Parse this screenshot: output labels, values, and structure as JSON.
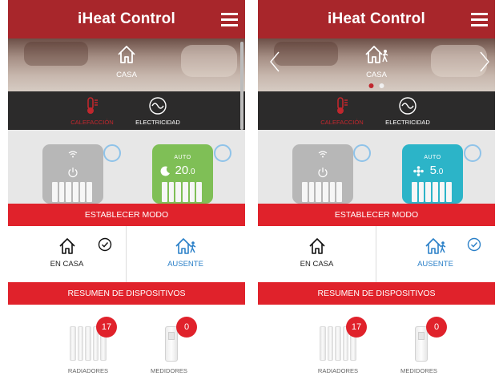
{
  "app": {
    "title": "iHeat Control"
  },
  "colors": {
    "brand": "#a8262b",
    "action_red": "#e0222b",
    "accent_blue": "#2b80c8",
    "device_green": "#7fbf56",
    "device_cyan": "#2cb4c8",
    "dark_bar": "#2c2b2b"
  },
  "screens": [
    {
      "hero": {
        "mode_label": "CASA",
        "mode_icon": "house-icon",
        "carousel_index": 0
      },
      "tabs": [
        {
          "label": "CALEFACCIÓN",
          "icon": "thermometer-icon",
          "active": true
        },
        {
          "label": "ELECTRICIDAD",
          "icon": "electricity-wave-icon",
          "active": false
        }
      ],
      "devices": [
        {
          "state": "off",
          "icon": "power-icon",
          "wifi": true
        },
        {
          "auto_label": "AUTO",
          "temp_int": "20",
          "temp_dec": ".0",
          "mode_icon": "moon-icon",
          "wifi": true
        }
      ],
      "set_mode_label": "ESTABLECER MODO",
      "modes": [
        {
          "label": "EN CASA",
          "icon": "house-icon",
          "selected": true
        },
        {
          "label": "AUSENTE",
          "icon": "house-away-icon",
          "selected": false
        }
      ],
      "summary_label": "RESUMEN DE DISPOSITIVOS",
      "summary": [
        {
          "label": "RADIADORES",
          "count": "17",
          "icon": "radiator-icon"
        },
        {
          "label": "MEDIDORES",
          "count": "0",
          "icon": "meter-icon"
        }
      ]
    },
    {
      "hero": {
        "mode_label": "CASA",
        "mode_icon": "house-away-icon",
        "carousel_index": 0
      },
      "tabs": [
        {
          "label": "CALEFACCIÓN",
          "icon": "thermometer-icon",
          "active": true
        },
        {
          "label": "ELECTRICIDAD",
          "icon": "electricity-wave-icon",
          "active": false
        }
      ],
      "devices": [
        {
          "state": "off",
          "icon": "power-icon",
          "wifi": true
        },
        {
          "auto_label": "AUTO",
          "temp_int": "5",
          "temp_dec": ".0",
          "mode_icon": "snowflake-icon",
          "wifi": true
        }
      ],
      "set_mode_label": "ESTABLECER MODO",
      "modes": [
        {
          "label": "EN CASA",
          "icon": "house-icon",
          "selected": false
        },
        {
          "label": "AUSENTE",
          "icon": "house-away-icon",
          "selected": true
        }
      ],
      "summary_label": "RESUMEN DE DISPOSITIVOS",
      "summary": [
        {
          "label": "RADIADORES",
          "count": "17",
          "icon": "radiator-icon"
        },
        {
          "label": "MEDIDORES",
          "count": "0",
          "icon": "meter-icon"
        }
      ]
    }
  ]
}
